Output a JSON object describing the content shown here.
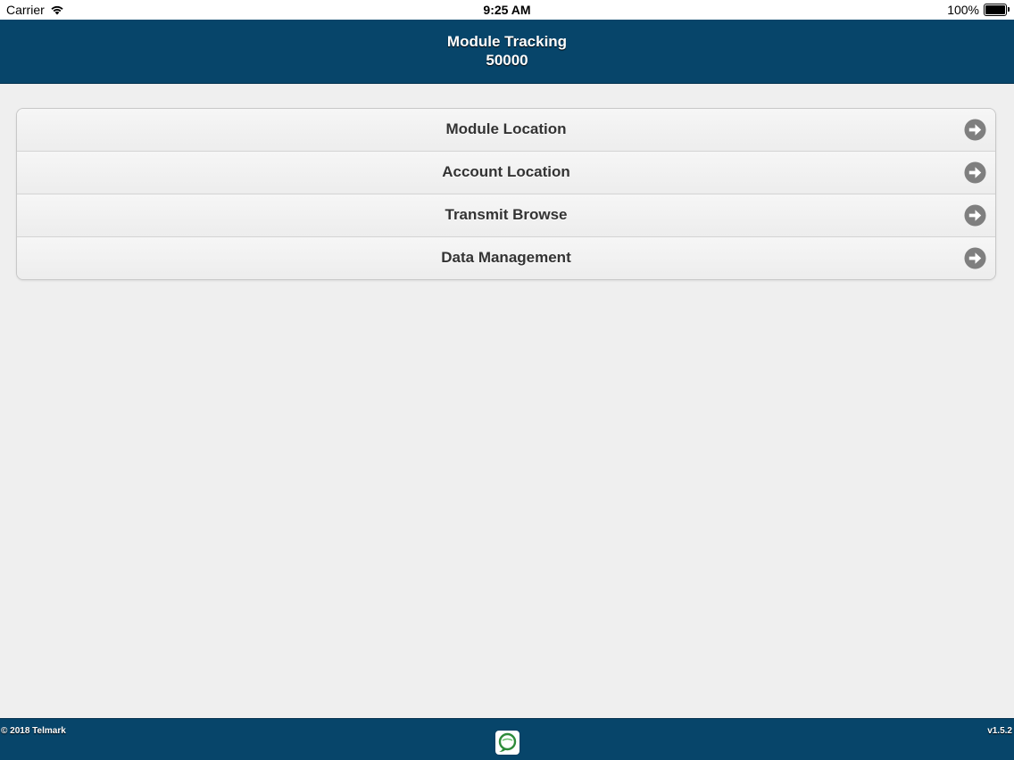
{
  "status_bar": {
    "carrier": "Carrier",
    "time": "9:25 AM",
    "battery": "100%",
    "battery_level": 1.0
  },
  "header": {
    "title": "Module Tracking",
    "subtitle": "50000"
  },
  "menu": {
    "items": [
      {
        "label": "Module Location",
        "icon": "arrow-right-circle-icon"
      },
      {
        "label": "Account Location",
        "icon": "arrow-right-circle-icon"
      },
      {
        "label": "Transmit Browse",
        "icon": "arrow-right-circle-icon"
      },
      {
        "label": "Data Management",
        "icon": "arrow-right-circle-icon"
      }
    ]
  },
  "footer": {
    "copyright": "© 2018 Telmark",
    "version": "v1.5.2",
    "logo_icon": "telmark-logo-icon"
  },
  "colors": {
    "header_background": "#07456a",
    "page_background": "#efefef",
    "menu_text": "#333333",
    "arrow_icon": "#808080"
  }
}
